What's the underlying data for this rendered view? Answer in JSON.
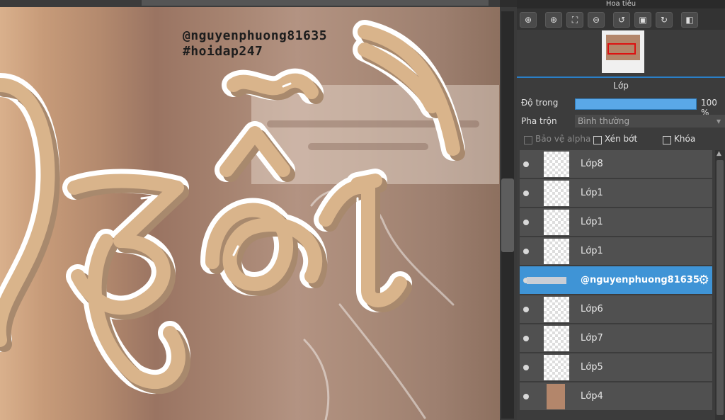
{
  "watermark": {
    "line1": "@nguyenphuong81635",
    "line2": "#hoidap247"
  },
  "navigator": {
    "title": "Hoa tiêu",
    "toolbar": [
      {
        "name": "zoom-fit-icon",
        "glyph": "⊕"
      },
      {
        "name": "zoom-in-icon",
        "glyph": "⊕"
      },
      {
        "name": "fit-screen-icon",
        "glyph": "⛶"
      },
      {
        "name": "zoom-out-icon",
        "glyph": "⊖"
      },
      {
        "name": "rotate-left-icon",
        "glyph": "↺"
      },
      {
        "name": "reset-view-icon",
        "glyph": "▣"
      },
      {
        "name": "rotate-right-icon",
        "glyph": "↻"
      },
      {
        "name": "flip-icon",
        "glyph": "◧"
      }
    ]
  },
  "layer_panel": {
    "title": "Lớp",
    "opacity_label": "Độ trong",
    "opacity_value": "100 %",
    "opacity_fraction": 1.0,
    "blend_label": "Pha trộn",
    "blend_value": "Bình thường",
    "checkboxes": [
      {
        "label": "Bảo vệ alpha",
        "checked": false,
        "disabled": true
      },
      {
        "label": "Xén bớt",
        "checked": false,
        "disabled": false
      },
      {
        "label": "Khóa",
        "checked": false,
        "disabled": false
      }
    ],
    "layers": [
      {
        "name": "Lớp8",
        "selected": false,
        "thumb": "checker"
      },
      {
        "name": "Lớp1",
        "selected": false,
        "thumb": "checker"
      },
      {
        "name": "Lớp1",
        "selected": false,
        "thumb": "checker"
      },
      {
        "name": "Lớp1",
        "selected": false,
        "thumb": "checker"
      },
      {
        "name": "@nguyenphuong81635",
        "selected": true,
        "thumb": "text"
      },
      {
        "name": "Lớp6",
        "selected": false,
        "thumb": "checker"
      },
      {
        "name": "Lớp7",
        "selected": false,
        "thumb": "checker"
      },
      {
        "name": "Lớp5",
        "selected": false,
        "thumb": "checker"
      },
      {
        "name": "Lớp4",
        "selected": false,
        "thumb": "photo"
      }
    ]
  },
  "colors": {
    "accent": "#3f94d6",
    "lettering": "#d9b48b",
    "lettering_shadow": "#a8896d"
  }
}
